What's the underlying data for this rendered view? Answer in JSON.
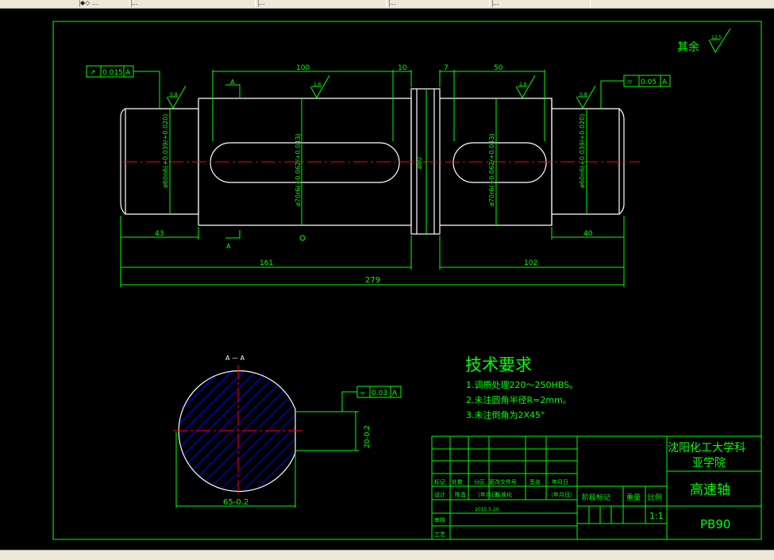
{
  "window": {
    "tabs": [
      {
        "label": "◆◇ ..."
      },
      {
        "label": "..."
      },
      {
        "label": "..."
      },
      {
        "label": "..."
      },
      {
        "label": "..."
      }
    ]
  },
  "drawing": {
    "roughness_other_label": "其余",
    "roughness_other_value": "12.5",
    "dims": {
      "d100": "100",
      "d10": "10",
      "d7": "7",
      "d50": "50",
      "d43": "43",
      "d161": "161",
      "d102": "102",
      "d40": "40",
      "d279": "279",
      "phi80": "ø80",
      "phi60_left": "ø60n6(+0.039/+0.020)",
      "phi70_left": "ø70r6(+0.062/+0.043)",
      "phi70_right": "ø70r6(+0.062/+0.043)",
      "phi60_right": "ø60n6(+0.039/+0.020)"
    },
    "roughness": {
      "r08_left": "0.8",
      "r16_mid": "1.6",
      "r16_right": "1.6",
      "r08_right": "0.8"
    },
    "tolerance_left": {
      "symbol": "↗",
      "value": "0.015",
      "datum": "A"
    },
    "tolerance_right": {
      "symbol": "⌭",
      "value": "0.05",
      "datum": "A"
    },
    "section_marker": "A",
    "section": {
      "title": "A — A",
      "tolerance": {
        "symbol": "⌯",
        "value": "0.03",
        "datum": "A"
      },
      "depth_dim": "20-0.2",
      "width_dim": "65-0.2",
      "depth_tol": "0/-0.2"
    }
  },
  "tech": {
    "title": "技术要求",
    "items": [
      "1.调质处理220～250HBS。",
      "2.未注圆角半径R=2mm。",
      "3.未注倒角为2X45°"
    ]
  },
  "titleblock": {
    "school": "沈阳化工大学科亚学院",
    "school_line1": "沈阳化工大学科",
    "school_line2": "亚学院",
    "part_name": "高速轴",
    "code": "PB90",
    "scale": "1:1",
    "headers": {
      "mark": "标记",
      "count": "处数",
      "zone": "分区",
      "change_doc": "更改文件号",
      "sign": "签名",
      "date": "年月日",
      "design": "设计",
      "standard": "标准化",
      "review": "审核",
      "craft": "工艺",
      "stage_mark": "阶段标记",
      "weight": "重量",
      "ratio": "比例",
      "date_sign_1": "（年月日）",
      "date_sign_2": "（年月日）"
    },
    "designer": "陈音",
    "date_value": "2015.5.20"
  },
  "colors": {
    "frame": "#00ff00",
    "outline": "#ffffff",
    "centerline": "#ff0000",
    "hatch": "#0000ff",
    "cross": "#ff0000"
  }
}
